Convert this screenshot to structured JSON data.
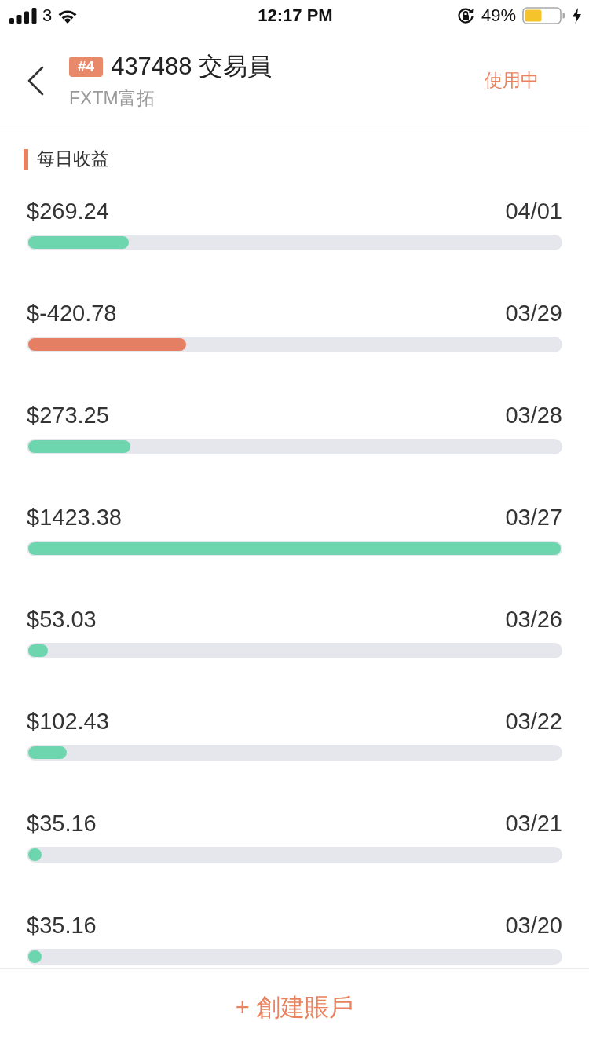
{
  "status_bar": {
    "carrier": "3",
    "time": "12:17 PM",
    "battery": "49%"
  },
  "header": {
    "badge": "#4",
    "title": "437488 交易員",
    "subtitle": "FXTM富拓",
    "status": "使用中"
  },
  "section": {
    "title": "每日收益"
  },
  "rows": [
    {
      "amount": "$269.24",
      "date": "04/01",
      "level": 0.189,
      "color": "#6dd6ae"
    },
    {
      "amount": "$-420.78",
      "date": "03/29",
      "level": 0.296,
      "color": "#e57f63"
    },
    {
      "amount": "$273.25",
      "date": "03/28",
      "level": 0.192,
      "color": "#6dd6ae"
    },
    {
      "amount": "$1423.38",
      "date": "03/27",
      "level": 1,
      "color": "#6dd6ae"
    },
    {
      "amount": "$53.03",
      "date": "03/26",
      "level": 0.037,
      "color": "#6dd6ae"
    },
    {
      "amount": "$102.43",
      "date": "03/22",
      "level": 0.072,
      "color": "#6dd6ae"
    },
    {
      "amount": "$35.16",
      "date": "03/21",
      "level": 0.025,
      "color": "#6dd6ae"
    },
    {
      "amount": "$35.16",
      "date": "03/20",
      "level": 0.025,
      "color": "#6dd6ae"
    }
  ],
  "footer": {
    "button": "+ 創建賬戶"
  }
}
